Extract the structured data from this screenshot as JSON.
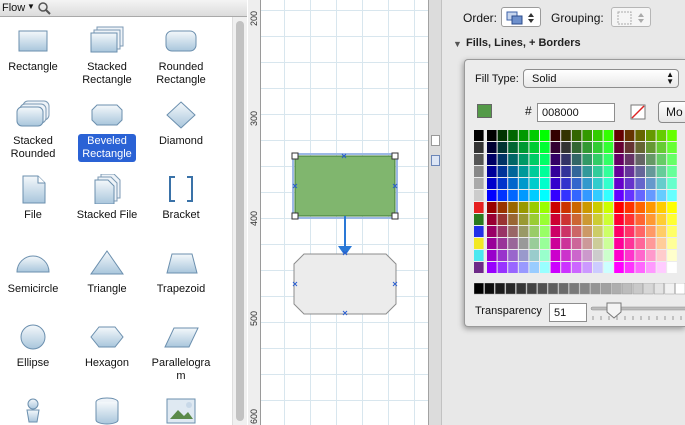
{
  "library": {
    "title": "Flow",
    "shapes": [
      {
        "label": "Rectangle"
      },
      {
        "label": "Stacked\nRectangle"
      },
      {
        "label": "Rounded\nRectangle"
      },
      {
        "label": "Stacked\nRounded"
      },
      {
        "label": "Beveled\nRectangle",
        "selected": true
      },
      {
        "label": "Diamond"
      },
      {
        "label": "File"
      },
      {
        "label": "Stacked File"
      },
      {
        "label": "Bracket"
      },
      {
        "label": "Semicircle"
      },
      {
        "label": "Triangle"
      },
      {
        "label": "Trapezoid"
      },
      {
        "label": "Ellipse"
      },
      {
        "label": "Hexagon"
      },
      {
        "label": "Parallelogra\nm"
      }
    ]
  },
  "ruler": {
    "labels": [
      "200",
      "300",
      "400",
      "500",
      "600"
    ]
  },
  "canvas": {
    "selected_shape_fill": "#80b66e",
    "selection_color": "#2a5fd0",
    "connector_color": "#2a78d6"
  },
  "inspector": {
    "order_label": "Order:",
    "grouping_label": "Grouping:",
    "section_title": "Fills, Lines, + Borders",
    "fill": {
      "type_label": "Fill Type:",
      "type_value": "Solid",
      "hash": "#",
      "hex_value": "008000",
      "swatch_color": "#549a48",
      "more_label": "Mo",
      "transparency_label": "Transparency",
      "transparency_value": "51"
    }
  }
}
